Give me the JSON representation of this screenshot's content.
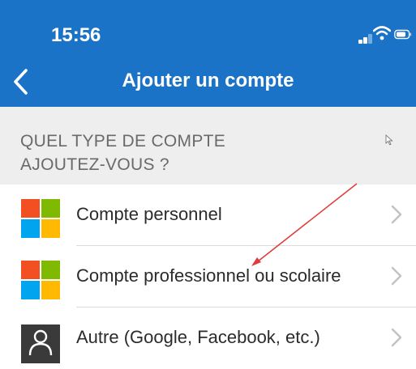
{
  "status_bar": {
    "time": "15:56",
    "icons": [
      "signal-icon",
      "wifi-icon",
      "battery-icon"
    ]
  },
  "nav": {
    "back_icon": "chevron-left-icon",
    "title": "Ajouter un compte"
  },
  "section": {
    "title": "QUEL TYPE DE COMPTE AJOUTEZ-VOUS ?"
  },
  "accounts": [
    {
      "label": "Compte personnel",
      "icon": "microsoft-logo-icon"
    },
    {
      "label": "Compte professionnel ou scolaire",
      "icon": "microsoft-logo-icon"
    },
    {
      "label": "Autre (Google, Facebook, etc.)",
      "icon": "person-icon"
    }
  ],
  "colors": {
    "header_bg": "#1a73c7",
    "section_bg": "#eeeeee",
    "ms_red": "#f25022",
    "ms_green": "#7fba00",
    "ms_blue": "#00a4ef",
    "ms_yellow": "#ffb900",
    "annotation_arrow": "#e03a3a"
  }
}
